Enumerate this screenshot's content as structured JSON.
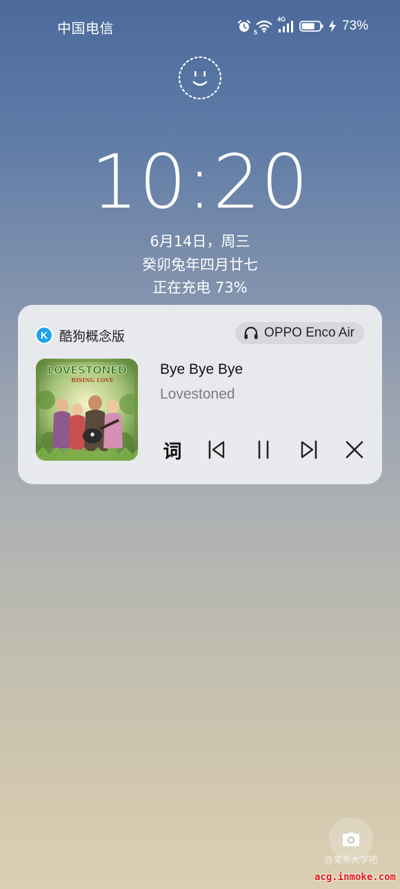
{
  "status_bar": {
    "carrier": "中国电信",
    "icons": [
      "alarm-icon",
      "wifi-icon",
      "4g-signal-icon",
      "battery-icon",
      "charging-bolt-icon"
    ],
    "wifi_badge": "5",
    "network_badge": "4G",
    "battery_percent": "73%",
    "battery_level": 0.73
  },
  "lock_screen": {
    "time": "10:20",
    "date": "6月14日，周三",
    "lunar_date": "癸卯兔年四月廿七",
    "charging_status": "正在充电 73%"
  },
  "media_card": {
    "app_name": "酷狗概念版",
    "app_icon_letter": "K",
    "output_device": "OPPO Enco Air",
    "album_art_title": "LOVESTONED",
    "album_art_subtitle": "RISING LOVE",
    "song_title": "Bye Bye Bye",
    "artist": "Lovestoned",
    "controls": {
      "lyrics_label": "词",
      "icons": [
        "previous-icon",
        "pause-icon",
        "next-icon",
        "close-icon"
      ]
    }
  },
  "watermark": {
    "faint_text": "@鬼东大学吧",
    "site": "acg.inmoke.com"
  },
  "colors": {
    "accent_app": "#1fa3e8",
    "watermark": "#e01010"
  }
}
